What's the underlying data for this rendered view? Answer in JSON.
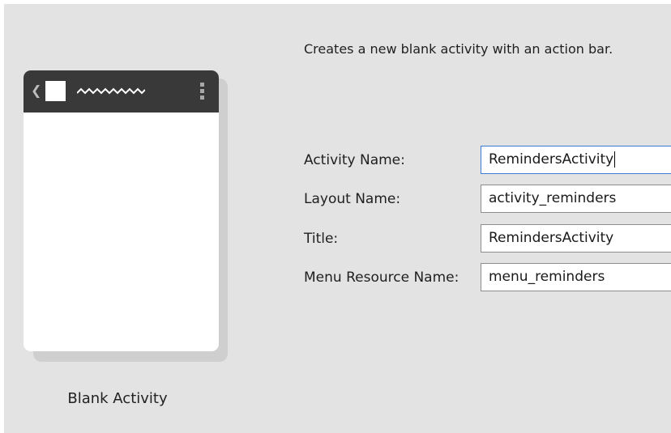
{
  "template": {
    "name": "Blank Activity",
    "description": "Creates a new blank activity with an action bar."
  },
  "preview": {
    "icons": [
      "back-chevron-icon",
      "app-icon",
      "title-placeholder-squiggle",
      "overflow-menu-icon"
    ],
    "action_bar_color": "#393939"
  },
  "form": {
    "activity_name": {
      "label": "Activity Name:",
      "value": "RemindersActivity"
    },
    "layout_name": {
      "label": "Layout Name:",
      "value": "activity_reminders"
    },
    "title": {
      "label": "Title:",
      "value": "RemindersActivity"
    },
    "menu_resource_name": {
      "label": "Menu Resource Name:",
      "value": "menu_reminders"
    }
  },
  "colors": {
    "background": "#e3e3e3",
    "focus_border": "#3a7bd5"
  }
}
